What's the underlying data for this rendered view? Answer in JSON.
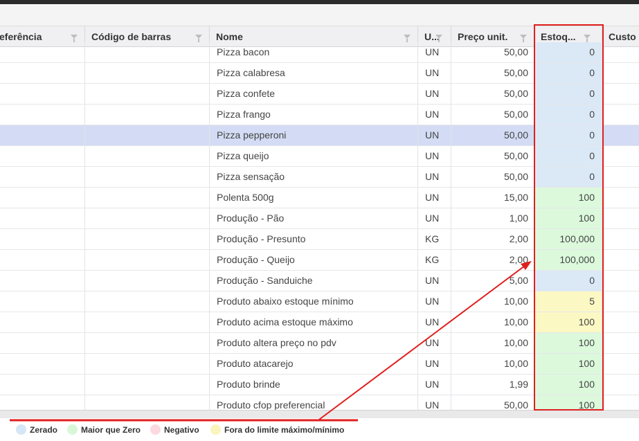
{
  "grid": {
    "columns": [
      {
        "key": "referencia",
        "label": "eferência"
      },
      {
        "key": "codigo_barras",
        "label": "Código de barras"
      },
      {
        "key": "nome",
        "label": "Nome"
      },
      {
        "key": "un",
        "label": "U..."
      },
      {
        "key": "preco",
        "label": "Preço unit."
      },
      {
        "key": "estoque",
        "label": "Estoq..."
      },
      {
        "key": "custo",
        "label": "Custo"
      }
    ],
    "rows": [
      {
        "nome": "Pizza bacon",
        "un": "UN",
        "preco": "50,00",
        "estoque": "0",
        "status": "zero"
      },
      {
        "nome": "Pizza calabresa",
        "un": "UN",
        "preco": "50,00",
        "estoque": "0",
        "status": "zero"
      },
      {
        "nome": "Pizza confete",
        "un": "UN",
        "preco": "50,00",
        "estoque": "0",
        "status": "zero"
      },
      {
        "nome": "Pizza frango",
        "un": "UN",
        "preco": "50,00",
        "estoque": "0",
        "status": "zero"
      },
      {
        "nome": "Pizza pepperoni",
        "un": "UN",
        "preco": "50,00",
        "estoque": "0",
        "status": "zero",
        "selected": true
      },
      {
        "nome": "Pizza queijo",
        "un": "UN",
        "preco": "50,00",
        "estoque": "0",
        "status": "zero"
      },
      {
        "nome": "Pizza sensação",
        "un": "UN",
        "preco": "50,00",
        "estoque": "0",
        "status": "zero"
      },
      {
        "nome": "Polenta 500g",
        "un": "UN",
        "preco": "15,00",
        "estoque": "100",
        "status": "pos"
      },
      {
        "nome": "Produção - Pão",
        "un": "UN",
        "preco": "1,00",
        "estoque": "100",
        "status": "pos"
      },
      {
        "nome": "Produção - Presunto",
        "un": "KG",
        "preco": "2,00",
        "estoque": "100,000",
        "status": "pos"
      },
      {
        "nome": "Produção - Queijo",
        "un": "KG",
        "preco": "2,00",
        "estoque": "100,000",
        "status": "pos"
      },
      {
        "nome": "Produção - Sanduiche",
        "un": "UN",
        "preco": "5,00",
        "estoque": "0",
        "status": "zero"
      },
      {
        "nome": "Produto abaixo estoque mínimo",
        "un": "UN",
        "preco": "10,00",
        "estoque": "5",
        "status": "fora"
      },
      {
        "nome": "Produto acima estoque máximo",
        "un": "UN",
        "preco": "10,00",
        "estoque": "100",
        "status": "fora"
      },
      {
        "nome": "Produto altera preço no pdv",
        "un": "UN",
        "preco": "10,00",
        "estoque": "100",
        "status": "pos"
      },
      {
        "nome": "Produto atacarejo",
        "un": "UN",
        "preco": "10,00",
        "estoque": "100",
        "status": "pos"
      },
      {
        "nome": "Produto brinde",
        "un": "UN",
        "preco": "1,99",
        "estoque": "100",
        "status": "pos"
      },
      {
        "nome": "Produto cfop preferencial",
        "un": "UN",
        "preco": "50,00",
        "estoque": "100",
        "status": "pos"
      }
    ]
  },
  "legend": {
    "items": [
      {
        "label": "Zerado",
        "color": "#d5e6f5"
      },
      {
        "label": "Maior que Zero",
        "color": "#d8f7d8"
      },
      {
        "label": "Negativo",
        "color": "#fbd9de"
      },
      {
        "label": "Fora do limite máximo/mínimo",
        "color": "#f9f5bd"
      }
    ]
  },
  "colors": {
    "annotation_red": "#e01e1e",
    "selected_row": "#d3dcf4",
    "est_zero": "#dbe9f6",
    "est_pos": "#dcf9dc",
    "est_fora": "#fbf8c4"
  }
}
